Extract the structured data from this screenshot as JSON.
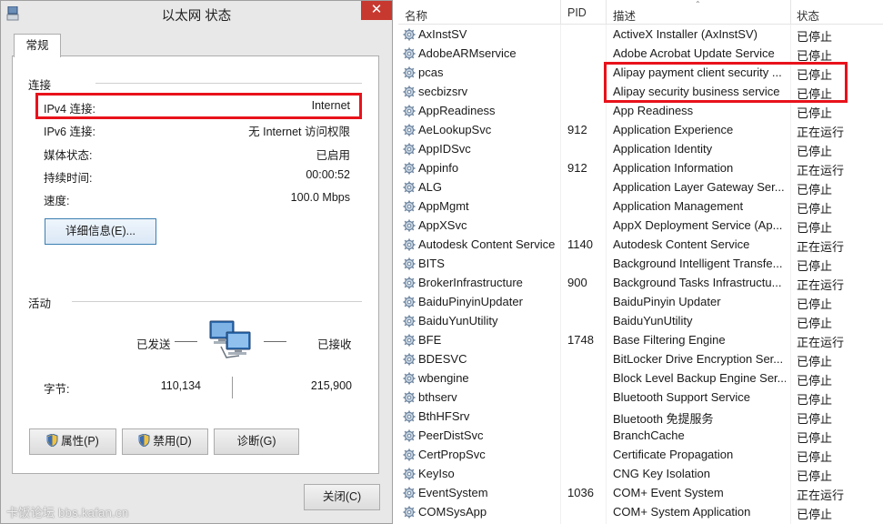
{
  "dialog": {
    "title": "以太网 状态",
    "close_glyph": "✕",
    "tab_label": "常规",
    "connection_section": "连接",
    "rows": [
      {
        "label": "IPv4 连接:",
        "value": "Internet"
      },
      {
        "label": "IPv6 连接:",
        "value": "无 Internet 访问权限"
      },
      {
        "label": "媒体状态:",
        "value": "已启用"
      },
      {
        "label": "持续时间:",
        "value": "00:00:52"
      },
      {
        "label": "速度:",
        "value": "100.0 Mbps"
      }
    ],
    "details_button": "详细信息(E)...",
    "activity_section": "活动",
    "sent_label": "已发送",
    "received_label": "已接收",
    "dash": "——",
    "bytes_label": "字节:",
    "bytes_sent": "110,134",
    "bytes_received": "215,900",
    "properties_button": "属性(P)",
    "disable_button": "禁用(D)",
    "diagnose_button": "诊断(G)",
    "close_button": "关闭(C)",
    "highlight_color": "#e8121b"
  },
  "watermark": "卡饭论坛 bbs.kafan.cn",
  "services": {
    "columns": {
      "name": "名称",
      "pid": "PID",
      "desc": "描述",
      "status": "状态"
    },
    "sort_glyph": "⌃",
    "rows": [
      {
        "name": "AxInstSV",
        "pid": "",
        "desc": "ActiveX Installer (AxInstSV)",
        "status": "已停止"
      },
      {
        "name": "AdobeARMservice",
        "pid": "",
        "desc": "Adobe Acrobat Update Service",
        "status": "已停止"
      },
      {
        "name": "pcas",
        "pid": "",
        "desc": "Alipay payment client security ...",
        "status": "已停止"
      },
      {
        "name": "secbizsrv",
        "pid": "",
        "desc": "Alipay security business service",
        "status": "已停止"
      },
      {
        "name": "AppReadiness",
        "pid": "",
        "desc": "App Readiness",
        "status": "已停止"
      },
      {
        "name": "AeLookupSvc",
        "pid": "912",
        "desc": "Application Experience",
        "status": "正在运行"
      },
      {
        "name": "AppIDSvc",
        "pid": "",
        "desc": "Application Identity",
        "status": "已停止"
      },
      {
        "name": "Appinfo",
        "pid": "912",
        "desc": "Application Information",
        "status": "正在运行"
      },
      {
        "name": "ALG",
        "pid": "",
        "desc": "Application Layer Gateway Ser...",
        "status": "已停止"
      },
      {
        "name": "AppMgmt",
        "pid": "",
        "desc": "Application Management",
        "status": "已停止"
      },
      {
        "name": "AppXSvc",
        "pid": "",
        "desc": "AppX Deployment Service (Ap...",
        "status": "已停止"
      },
      {
        "name": "Autodesk Content Service",
        "pid": "1140",
        "desc": "Autodesk Content Service",
        "status": "正在运行"
      },
      {
        "name": "BITS",
        "pid": "",
        "desc": "Background Intelligent Transfe...",
        "status": "已停止"
      },
      {
        "name": "BrokerInfrastructure",
        "pid": "900",
        "desc": "Background Tasks Infrastructu...",
        "status": "正在运行"
      },
      {
        "name": "BaiduPinyinUpdater",
        "pid": "",
        "desc": "BaiduPinyin Updater",
        "status": "已停止"
      },
      {
        "name": "BaiduYunUtility",
        "pid": "",
        "desc": "BaiduYunUtility",
        "status": "已停止"
      },
      {
        "name": "BFE",
        "pid": "1748",
        "desc": "Base Filtering Engine",
        "status": "正在运行"
      },
      {
        "name": "BDESVC",
        "pid": "",
        "desc": "BitLocker Drive Encryption Ser...",
        "status": "已停止"
      },
      {
        "name": "wbengine",
        "pid": "",
        "desc": "Block Level Backup Engine Ser...",
        "status": "已停止"
      },
      {
        "name": "bthserv",
        "pid": "",
        "desc": "Bluetooth Support Service",
        "status": "已停止"
      },
      {
        "name": "BthHFSrv",
        "pid": "",
        "desc": "Bluetooth 免提服务",
        "status": "已停止"
      },
      {
        "name": "PeerDistSvc",
        "pid": "",
        "desc": "BranchCache",
        "status": "已停止"
      },
      {
        "name": "CertPropSvc",
        "pid": "",
        "desc": "Certificate Propagation",
        "status": "已停止"
      },
      {
        "name": "KeyIso",
        "pid": "",
        "desc": "CNG Key Isolation",
        "status": "已停止"
      },
      {
        "name": "EventSystem",
        "pid": "1036",
        "desc": "COM+ Event System",
        "status": "正在运行"
      },
      {
        "name": "COMSysApp",
        "pid": "",
        "desc": "COM+ System Application",
        "status": "已停止"
      }
    ]
  }
}
